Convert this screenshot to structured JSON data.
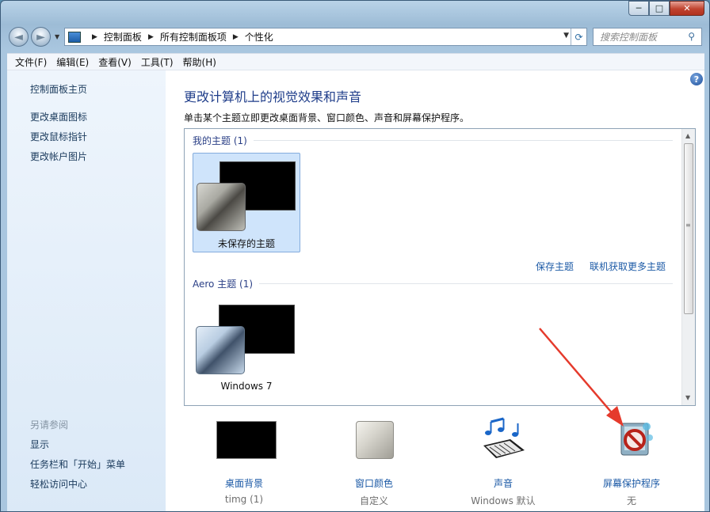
{
  "window": {
    "minimize_glyph": "─",
    "maximize_glyph": "□",
    "close_glyph": "✕"
  },
  "nav": {
    "back_glyph": "◄",
    "forward_glyph": "►",
    "breadcrumbs": [
      "控制面板",
      "所有控制面板项",
      "个性化"
    ],
    "search_placeholder": "搜索控制面板"
  },
  "menu": [
    "文件(F)",
    "编辑(E)",
    "查看(V)",
    "工具(T)",
    "帮助(H)"
  ],
  "sidebar": {
    "home": "控制面板主页",
    "links": [
      "更改桌面图标",
      "更改鼠标指针",
      "更改帐户图片"
    ],
    "see_also_title": "另请参阅",
    "see_also": [
      "显示",
      "任务栏和「开始」菜单",
      "轻松访问中心"
    ]
  },
  "main": {
    "help_glyph": "?",
    "title": "更改计算机上的视觉效果和声音",
    "description": "单击某个主题立即更改桌面背景、窗口颜色、声音和屏幕保护程序。",
    "groups": [
      {
        "header": "我的主题 (1)",
        "themes": [
          {
            "label": "未保存的主题",
            "selected": true
          }
        ]
      },
      {
        "header": "Aero 主题 (1)",
        "themes": [
          {
            "label": "Windows 7",
            "selected": false
          }
        ]
      }
    ],
    "links": {
      "save_theme": "保存主题",
      "get_more": "联机获取更多主题"
    }
  },
  "bottom": [
    {
      "title": "桌面背景",
      "subtitle": "timg (1)",
      "icon": "wallpaper-icon"
    },
    {
      "title": "窗口颜色",
      "subtitle": "自定义",
      "icon": "window-color-icon"
    },
    {
      "title": "声音",
      "subtitle": "Windows 默认",
      "icon": "music-notes-icon"
    },
    {
      "title": "屏幕保护程序",
      "subtitle": "无",
      "icon": "screensaver-icon"
    }
  ],
  "colors": {
    "link": "#1c5aa6",
    "title": "#1f3d8a",
    "selected_tile": "#cfe4fb",
    "annotation_arrow": "#e53a2c"
  }
}
